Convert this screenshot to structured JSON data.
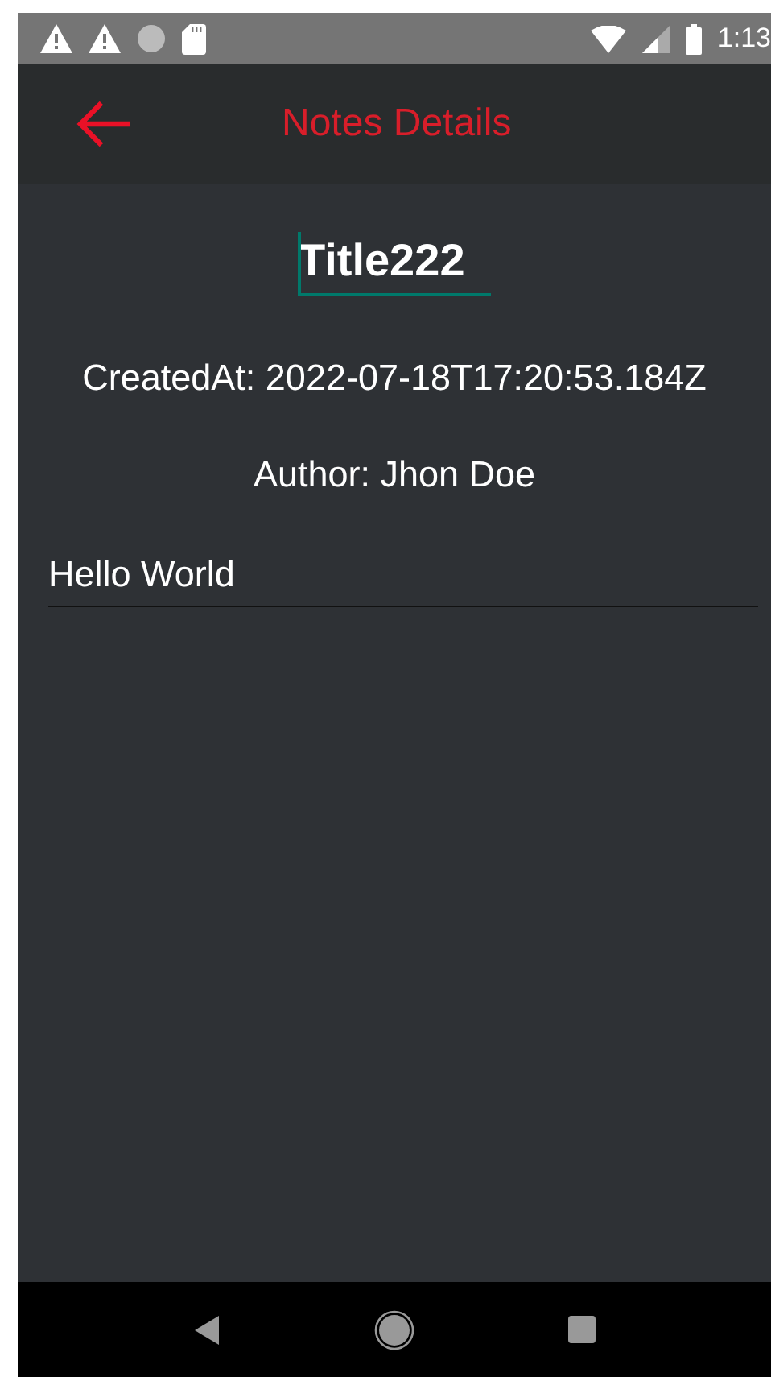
{
  "status_bar": {
    "time": "1:13"
  },
  "app_bar": {
    "title": "Notes Details"
  },
  "note": {
    "title_field": {
      "value": "Title222",
      "focused": true
    },
    "created_at": "CreatedAt: 2022-07-18T17:20:53.184Z",
    "author": "Author: Jhon Doe",
    "body_field": {
      "value": "Hello World",
      "focused": false
    }
  }
}
